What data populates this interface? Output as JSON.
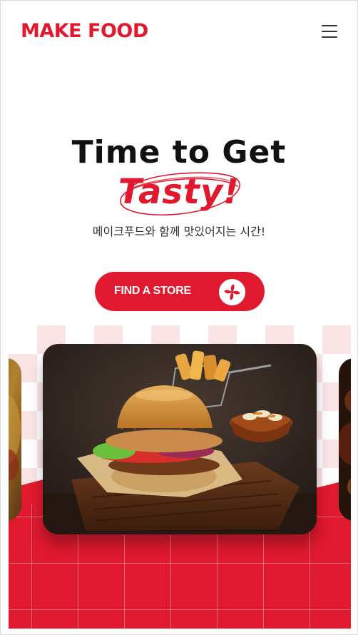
{
  "header": {
    "logo_text": "MAKE FOOD",
    "menu_icon": "hamburger-menu-icon"
  },
  "hero": {
    "title": "Time to Get",
    "accent": "Tasty!",
    "subtitle": "메이크푸드와 함께 맛있어지는 시간!"
  },
  "cta": {
    "label": "FIND A STORE",
    "icon": "pinwheel-icon"
  },
  "colors": {
    "brand_red": "#e0192e",
    "checker_pink": "#fbe4e6",
    "text_dark": "#111111"
  },
  "showcase": {
    "main_image": "burger-with-fries-and-coleslaw-photo",
    "side_images": [
      "food-photo-left",
      "food-photo-right"
    ]
  }
}
